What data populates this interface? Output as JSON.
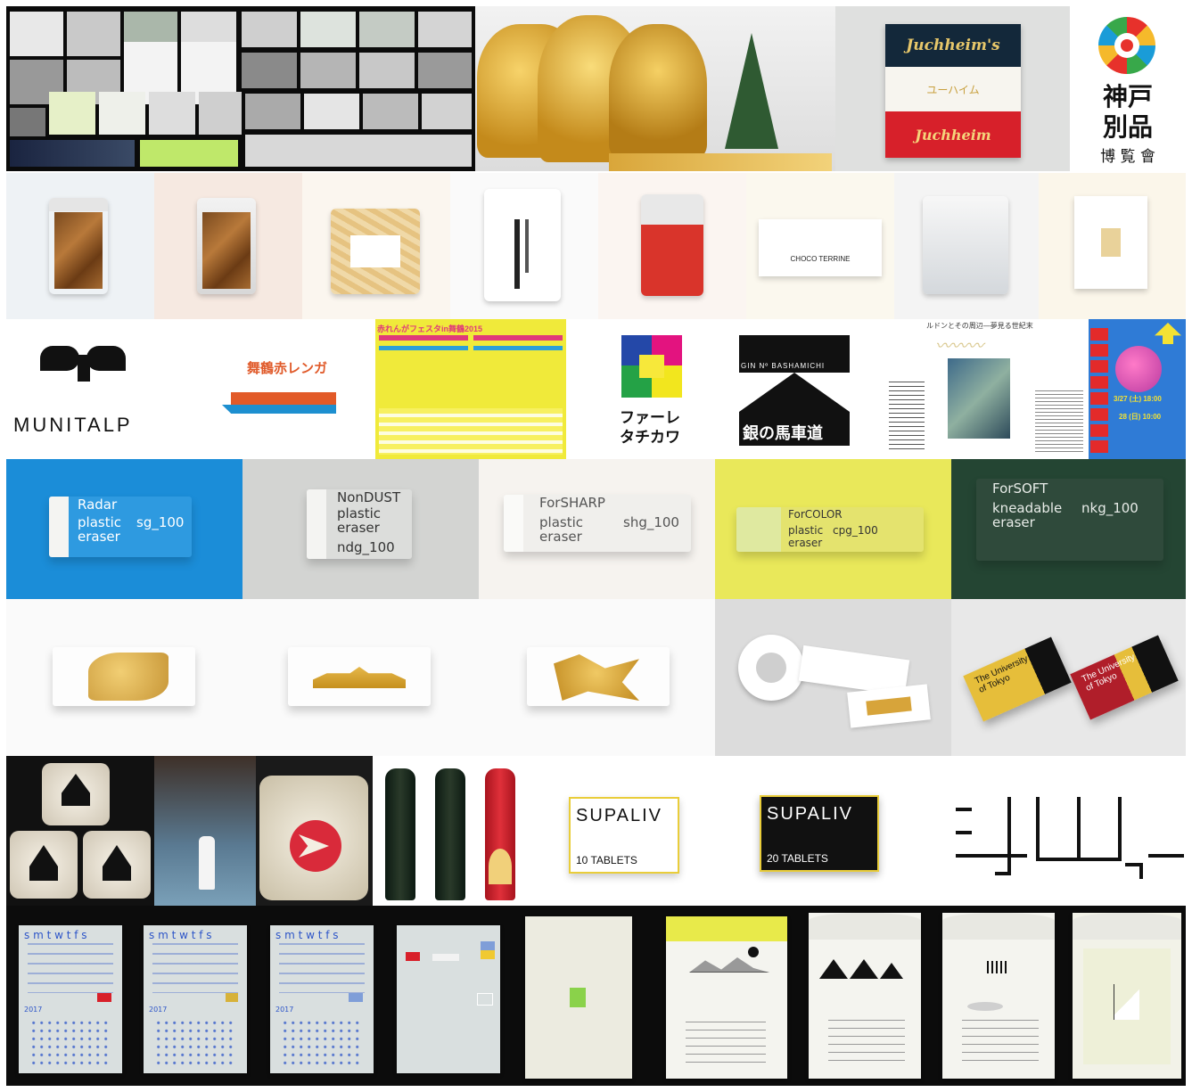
{
  "portfolio": {
    "juchheim": {
      "top": "Juchheim's",
      "mid": "ユーハイム",
      "bottom": "Juchheim"
    },
    "kobe": {
      "line1": "神戸",
      "line2": "別品",
      "line3": "博 覧 會"
    },
    "snacks": {
      "choco_label": "CHOCO TERRINE"
    },
    "logos": {
      "munitalp": "MUNITALP",
      "maizuru": "舞鶴赤レンガ",
      "fest_title": "赤れんがフェスタin舞鶴2015",
      "faret_line1": "ファーレ",
      "faret_line2": "タチカワ",
      "ginza_top": "GIN Nº BASHAMICHI",
      "ginza_bottom": "銀の馬車道",
      "redon_title": "ルドンとその周辺―夢見る世紀末",
      "roppongi_date1": "3/27 (土) 18:00",
      "roppongi_date2": "28 (日) 10:00"
    },
    "erasers": [
      {
        "name": "Radar",
        "line1": "plastic",
        "line2": "eraser",
        "code": "sg_100",
        "color": "#1b8dd8"
      },
      {
        "name": "NonDUST",
        "line1": "plastic",
        "line2": "eraser",
        "code": "ndg_100",
        "color": "#d3d4d2"
      },
      {
        "name": "ForSHARP",
        "line1": "plastic",
        "line2": "eraser",
        "code": "shg_100",
        "color": "#f6f3ef"
      },
      {
        "name": "ForCOLOR",
        "line1": "plastic",
        "line2": "eraser",
        "code": "cpg_100",
        "color": "#e9e85a"
      },
      {
        "name": "ForSOFT",
        "line1": "kneadable",
        "line2": "eraser",
        "code": "nkg_100",
        "color": "#244533"
      }
    ],
    "utokyo": {
      "label": "The University of Tokyo"
    },
    "supaliv": [
      {
        "brand": "SUPALIV",
        "tablets": "10 TABLETS"
      },
      {
        "brand": "SUPALIV",
        "tablets": "20 TABLETS"
      }
    ],
    "calendars": {
      "week_header": "s m t w t f s",
      "year": "2017"
    }
  }
}
